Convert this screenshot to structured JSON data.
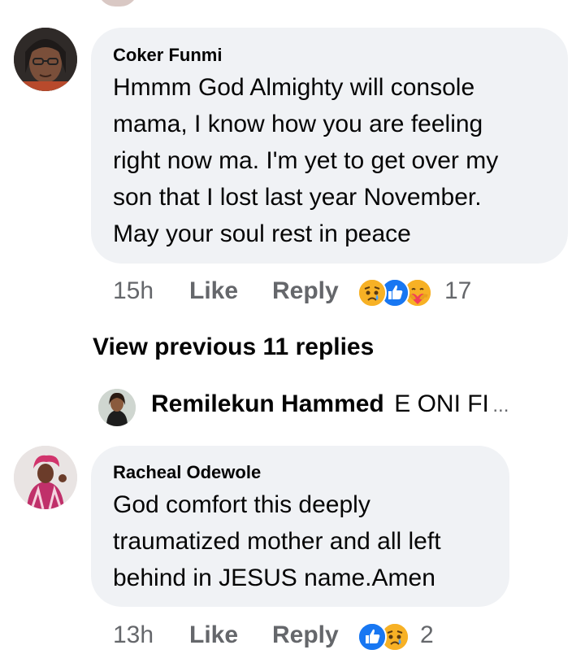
{
  "comments": [
    {
      "author": "Coker Funmi",
      "lines": [
        "Hmmm God Almighty will console",
        "mama, I know  how you are feeling",
        "right now ma. I'm yet to get over my",
        "son that I lost last year November.",
        "May your soul rest in peace"
      ],
      "time": "15h",
      "like_label": "Like",
      "reply_label": "Reply",
      "reactions": [
        "sad-emoji-icon",
        "like-icon",
        "care-emoji-icon"
      ],
      "reaction_count": "17"
    },
    {
      "author": "Racheal Odewole",
      "lines": [
        "God comfort this deeply",
        "traumatized mother and all left",
        "behind in JESUS name.Amen"
      ],
      "time": "13h",
      "like_label": "Like",
      "reply_label": "Reply",
      "reactions": [
        "like-icon",
        "sad-emoji-icon"
      ],
      "reaction_count": "2"
    }
  ],
  "thread": {
    "view_previous": "View previous 11 replies",
    "reply_preview": {
      "author": "Remilekun Hammed",
      "snippet": "E ONI FI",
      "ellipsis": "..."
    }
  },
  "colors": {
    "bubble": "#f0f2f5",
    "meta_text": "#65676b",
    "like_blue": "#1877f2",
    "sad_yellow": "#f7b125"
  }
}
